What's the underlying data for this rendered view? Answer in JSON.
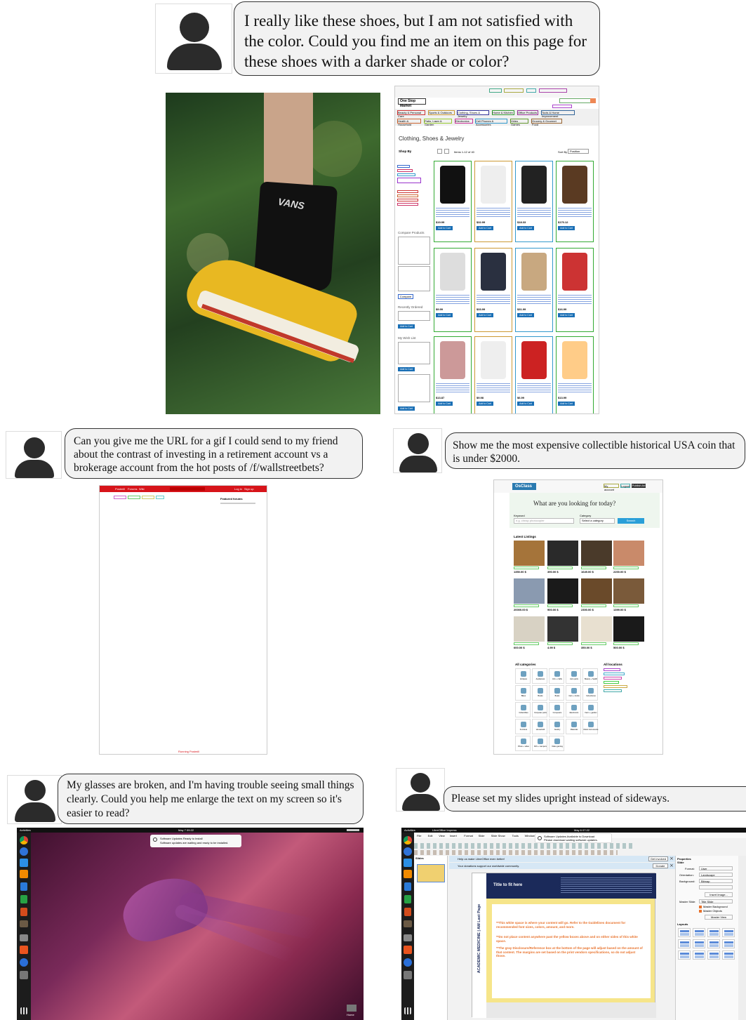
{
  "examples": [
    {
      "prompt": "I really like these shoes, but I am not satisfied with the color. Could you find me an item on this page for these shoes with a darker shade or color?"
    },
    {
      "prompt": "Can you give me the URL for a gif I could send to my friend about the contrast of investing in a retirement account vs a brokerage account from the hot posts of /f/wallstreetbets?"
    },
    {
      "prompt": "Show me the most expensive collectible historical USA coin that is under $2000."
    },
    {
      "prompt": "My glasses are broken, and I'm having trouble seeing small things clearly. Could you help me enlarge the text on my screen so it's easier to read?"
    },
    {
      "prompt": "Please set my slides upright instead of sideways."
    }
  ],
  "shop": {
    "logo": "One Stop Market",
    "title": "Clothing, Shoes & Jewelry",
    "shop_by": "Shop By",
    "items_count": "Items 1-12 of 40",
    "sort_label": "Sort By",
    "sort_value": "Position",
    "compare_products": "Compare Products",
    "recently_ordered": "Recently Ordered",
    "my_wish_list": "My Wish List",
    "add_to_cart": "Add to Cart",
    "compare_btn": "Compare",
    "prices": [
      "$19.99",
      "$32.99",
      "$18.33",
      "$170.12",
      "$9.99",
      "$33.99",
      "$31.99",
      "$16.99",
      "$13.87",
      "$9.98",
      "$6.99",
      "$13.99"
    ],
    "nav": [
      "Beauty & Personal Care",
      "Sports & Outdoors",
      "Clothing, Shoes & Jewelry",
      "Home & Kitchen",
      "Office Products",
      "Tools & Home Improvement",
      "Health & Household",
      "Patio, Lawn & Garden",
      "Electronics",
      "Cell Phones & Accessories",
      "Video Games",
      "Grocery & Gourmet Food"
    ]
  },
  "forum": {
    "tabs": [
      "Postmill",
      "Forums",
      "Wiki"
    ],
    "buttons": [
      "Log in",
      "Sign up"
    ],
    "featured": "Featured forums",
    "footer": "Running Postmill"
  },
  "classifieds": {
    "logo": "OsClass",
    "my_account": "My account",
    "logout": "Logout",
    "publish": "Publish Ad",
    "hero": "What are you looking for today?",
    "keyword_label": "Keyword",
    "keyword_placeholder": "e.g. cheap photocopier",
    "category_label": "Category",
    "category_value": "Select a category",
    "search_btn": "Search",
    "latest": "Latest Listings",
    "prices": [
      "1350.00 $",
      "390.00 $",
      "1649.00 $",
      "2200.00 $",
      "20000.00 $",
      "900.00 $",
      "2300.00 $",
      "1399.00 $",
      "600.00 $",
      "4.99 $",
      "350.00 $",
      "500.00 $"
    ],
    "all_categories": "All categories",
    "all_locations": "All locations",
    "categories": [
      "Antiques",
      "Appliances",
      "Arts + crafts",
      "Auto parts",
      "Beauty + health",
      "Bikes",
      "Books",
      "Boats",
      "Cars + trucks",
      "Cell phones",
      "Collectibles",
      "Computer parts",
      "Computers",
      "Electronics",
      "Farm + garden",
      "Furniture",
      "Household",
      "Jewelry",
      "Materials",
      "Music instruments",
      "Photo + video",
      "RVs + campers",
      "Video gaming"
    ]
  },
  "ubuntu": {
    "activities": "Activities",
    "clock": "May 7  09:22",
    "notif_title": "Software Updates Ready to Install",
    "notif_body": "Software updates are waiting and ready to be installed.",
    "trash": "Home"
  },
  "impress": {
    "activities": "Activities",
    "app": "LibreOffice Impress",
    "clock": "May 6  07:22",
    "notif_title": "Software Updates Available to Download",
    "notif_body": "Please download waiting software updates.",
    "menu": [
      "File",
      "Edit",
      "View",
      "Insert",
      "Format",
      "Slide",
      "Slide Show",
      "Tools",
      "Window",
      "Help"
    ],
    "slides_label": "Slides",
    "info1": "Help us make LibreOffice even better!",
    "info1_btn": "Get involved",
    "info2": "Your donations support our worldwide community.",
    "info2_btn": "Donate",
    "slide_title": "Title to fit here",
    "side_text": "ACADEMIC MEDICINE | AM Last Page",
    "body1": "**This white space is where your content will go. Refer to the Guidelines document for recommended font sizes, colors, amount, and more.",
    "body2": "**Do not place content anywhere past the yellow boxes above and on either sides of this white space.",
    "body3": "**The gray Disclosure/Reference box at the bottom of the page will adjust based on the amount of that content. The margins are set based on the print vendors specifications, so do not adjust those.",
    "properties": "Properties",
    "slide_section": "Slide",
    "format_label": "Format:",
    "format_value": "User",
    "orientation_label": "Orientation:",
    "orientation_value": "Landscape",
    "background_label": "Background:",
    "background_value": "Bitmap",
    "insert_image": "Insert Image...",
    "master_label": "Master Slide:",
    "master_value": "Title Slide",
    "master_bg": "Master Background",
    "master_obj": "Master Objects",
    "master_view": "Master View",
    "layouts": "Layouts"
  },
  "colors": {
    "shop_blue": "#1979c3",
    "forum_red": "#d7141a",
    "ubuntu_purple": "#7a2a5a",
    "impress_info": "#d6e7f5"
  }
}
